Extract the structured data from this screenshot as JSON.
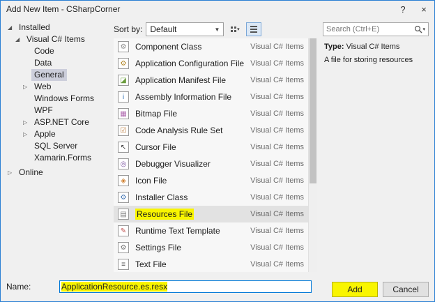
{
  "window": {
    "title": "Add New Item - CSharpCorner",
    "help_glyph": "?",
    "close_glyph": "×"
  },
  "sidebar": {
    "items": [
      {
        "label": "Installed",
        "indent": 0,
        "arrow": "expanded"
      },
      {
        "label": "Visual C# Items",
        "indent": 1,
        "arrow": "expanded"
      },
      {
        "label": "Code",
        "indent": 2,
        "arrow": "none"
      },
      {
        "label": "Data",
        "indent": 2,
        "arrow": "none"
      },
      {
        "label": "General",
        "indent": 2,
        "arrow": "none",
        "selected": true
      },
      {
        "label": "Web",
        "indent": 2,
        "arrow": "collapsed"
      },
      {
        "label": "Windows Forms",
        "indent": 2,
        "arrow": "none"
      },
      {
        "label": "WPF",
        "indent": 2,
        "arrow": "none"
      },
      {
        "label": "ASP.NET Core",
        "indent": 2,
        "arrow": "collapsed"
      },
      {
        "label": "Apple",
        "indent": 2,
        "arrow": "collapsed"
      },
      {
        "label": "SQL Server",
        "indent": 2,
        "arrow": "none"
      },
      {
        "label": "Xamarin.Forms",
        "indent": 2,
        "arrow": "none"
      },
      {
        "label": "Online",
        "indent": 0,
        "arrow": "collapsed",
        "gap_before": true
      }
    ]
  },
  "toolbar": {
    "sort_label": "Sort by:",
    "sort_value": "Default"
  },
  "search": {
    "placeholder": "Search (Ctrl+E)"
  },
  "list": {
    "items": [
      {
        "name": "Component Class",
        "category": "Visual C# Items",
        "icon": "component-class-icon",
        "glyph": "⚙",
        "color": "#8a8a8a"
      },
      {
        "name": "Application Configuration File",
        "category": "Visual C# Items",
        "icon": "app-configuration-file-icon",
        "glyph": "⚙",
        "color": "#b58a2d"
      },
      {
        "name": "Application Manifest File",
        "category": "Visual C# Items",
        "icon": "app-manifest-file-icon",
        "glyph": "◪",
        "color": "#6a9c3d"
      },
      {
        "name": "Assembly Information File",
        "category": "Visual C# Items",
        "icon": "assembly-information-file-icon",
        "glyph": "i",
        "color": "#2d6fb5"
      },
      {
        "name": "Bitmap File",
        "category": "Visual C# Items",
        "icon": "bitmap-file-icon",
        "glyph": "▦",
        "color": "#b06ab0"
      },
      {
        "name": "Code Analysis Rule Set",
        "category": "Visual C# Items",
        "icon": "code-analysis-rule-set-icon",
        "glyph": "☑",
        "color": "#b5702d"
      },
      {
        "name": "Cursor File",
        "category": "Visual C# Items",
        "icon": "cursor-file-icon",
        "glyph": "↖",
        "color": "#333333"
      },
      {
        "name": "Debugger Visualizer",
        "category": "Visual C# Items",
        "icon": "debugger-visualizer-icon",
        "glyph": "◎",
        "color": "#7a52a0"
      },
      {
        "name": "Icon File",
        "category": "Visual C# Items",
        "icon": "icon-file-icon",
        "glyph": "◈",
        "color": "#d08030"
      },
      {
        "name": "Installer Class",
        "category": "Visual C# Items",
        "icon": "installer-class-icon",
        "glyph": "⚙",
        "color": "#4a7ab5"
      },
      {
        "name": "Resources File",
        "category": "Visual C# Items",
        "icon": "resources-file-icon",
        "glyph": "▤",
        "color": "#777777",
        "selected": true
      },
      {
        "name": "Runtime Text Template",
        "category": "Visual C# Items",
        "icon": "runtime-text-template-icon",
        "glyph": "✎",
        "color": "#c0504d"
      },
      {
        "name": "Settings File",
        "category": "Visual C# Items",
        "icon": "settings-file-icon",
        "glyph": "⚙",
        "color": "#777777"
      },
      {
        "name": "Text File",
        "category": "Visual C# Items",
        "icon": "text-file-icon",
        "glyph": "≡",
        "color": "#555555"
      }
    ]
  },
  "details": {
    "type_label": "Type:",
    "type_value": "Visual C# Items",
    "description": "A file for storing resources"
  },
  "bottom": {
    "name_label": "Name:",
    "name_value": "ApplicationResource.es.resx",
    "add_label": "Add",
    "cancel_label": "Cancel"
  },
  "colors": {
    "accent": "#2a7fd4",
    "highlight": "#f9f500",
    "selection": "#cccedb",
    "row-selection": "#e2e2e2"
  }
}
